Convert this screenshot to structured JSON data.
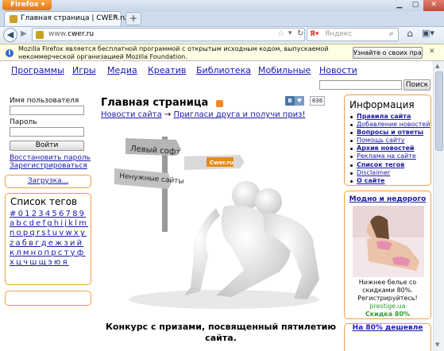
{
  "browser": {
    "app_button": "Firefox",
    "tab_title": "Главная страница | CWER.ru",
    "new_tab": "+",
    "url_prefix": "www.",
    "url_host": "cwer.ru",
    "search_placeholder": "Яндекс",
    "search_engine_icon": "yandex-icon"
  },
  "infobar": {
    "text": "Mozilla Firefox является бесплатной программой с открытым исходным кодом, выпускаемой некоммерческой организацией Mozilla Foundation.",
    "button": "Узнайте о своих правах..."
  },
  "topnav": [
    "Программы",
    "Игры",
    "Медиа",
    "Креатив",
    "Библиотека",
    "Мобильные",
    "Новости"
  ],
  "site_search": {
    "button": "Поиск"
  },
  "login": {
    "username_label": "Имя пользователя",
    "password_label": "Пароль",
    "login_button": "Войти",
    "restore_link": "Восстановить пароль",
    "register_link": "Зарегистрироваться"
  },
  "loading": "Загрузка...",
  "tags": {
    "title": "Список тегов",
    "letters": "#0123456789abcdefghijklmnopqrstuvwxyzабвгдежзийклмнопрстуфхцчшщэюя"
  },
  "main": {
    "title": "Главная страница",
    "vk_label": "B",
    "like_count": "836",
    "news_link": "Новости сайта",
    "arrow": "→",
    "invite_link": "Пригласи друга и получи приз!",
    "hero_signs": [
      "Левый софт",
      "Ненужные сайты",
      "Cwer.ru"
    ],
    "contest": "Конкурс с призами, посвященный пятилетию сайта."
  },
  "info": {
    "title": "Информация",
    "links": [
      {
        "text": "Правила сайта",
        "bold": true
      },
      {
        "text": "Добавление новостей",
        "bold": false
      },
      {
        "text": "Вопросы и ответы",
        "bold": true
      },
      {
        "text": "Помощь сайту",
        "bold": false
      },
      {
        "text": "Архив новостей",
        "bold": true
      },
      {
        "text": "Реклама на сайте",
        "bold": false
      },
      {
        "text": "Список тегов",
        "bold": true
      },
      {
        "text": "Disclaimer",
        "bold": false
      },
      {
        "text": "О сайте",
        "bold": true
      }
    ]
  },
  "ad": {
    "title": "Модно и недорого",
    "line1": "Нижнее белье со",
    "line2": "скидками 80%.",
    "line3": "Регистрируйтесь!",
    "brand": "prestige.ua",
    "sale": "Скидка 80%"
  },
  "ad2": {
    "title": "На 80% дешевле"
  },
  "colors": {
    "accent": "#f0a040",
    "link": "#1a1aa6",
    "firefox": "#e3761b"
  }
}
